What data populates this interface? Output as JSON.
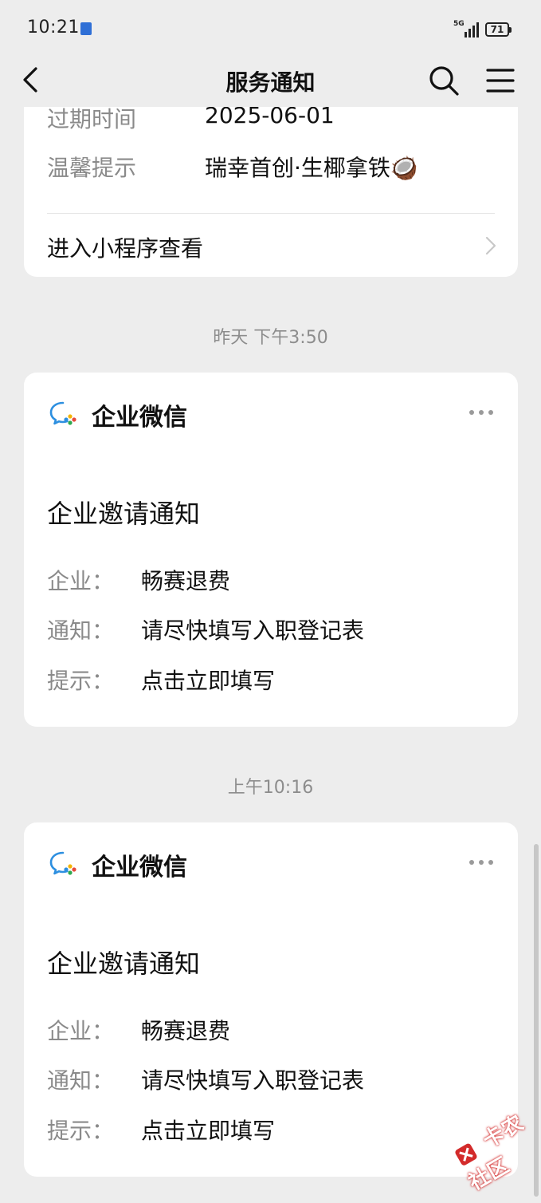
{
  "status_bar": {
    "time": "10:21",
    "network": "5G",
    "battery": "71"
  },
  "navbar": {
    "title": "服务通知"
  },
  "card_top": {
    "rows": [
      {
        "label": "过期时间",
        "value": "2025-06-01"
      },
      {
        "label": "温馨提示",
        "value": "瑞幸首创·生椰拿铁🥥"
      }
    ],
    "link_label": "进入小程序查看"
  },
  "messages": [
    {
      "timestamp": "昨天 下午3:50",
      "app_name": "企业微信",
      "title": "企业邀请通知",
      "rows": [
        {
          "label": "企业：",
          "value": "畅赛退费"
        },
        {
          "label": "通知：",
          "value": "请尽快填写入职登记表"
        },
        {
          "label": "提示：",
          "value": "点击立即填写"
        }
      ]
    },
    {
      "timestamp": "上午10:16",
      "app_name": "企业微信",
      "title": "企业邀请通知",
      "rows": [
        {
          "label": "企业：",
          "value": "畅赛退费"
        },
        {
          "label": "通知：",
          "value": "请尽快填写入职登记表"
        },
        {
          "label": "提示：",
          "value": "点击立即填写"
        }
      ]
    }
  ],
  "watermark": "卡农社区",
  "colors": {
    "background": "#ededed",
    "card": "#ffffff",
    "label": "#8a8a8a",
    "timestamp": "#8d8d8d"
  },
  "icons": [
    "back-arrow-icon",
    "search-icon",
    "menu-icon",
    "wecom-icon",
    "more-dots-icon",
    "chevron-right-icon"
  ]
}
